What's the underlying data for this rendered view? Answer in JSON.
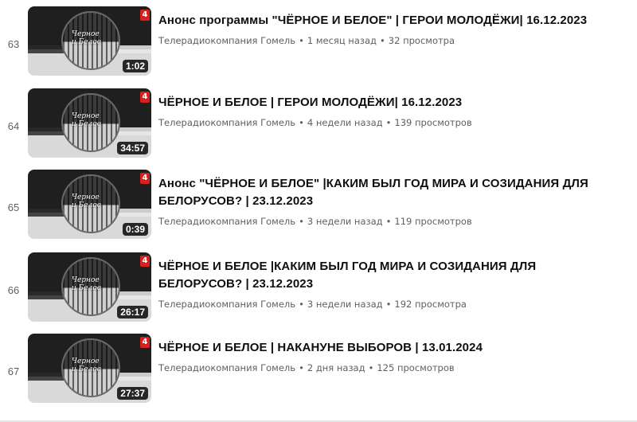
{
  "videos": [
    {
      "index": "63",
      "title": "Анонс программы \"ЧЁРНОЕ И БЕЛОЕ\" | ГЕРОИ МОЛОДЁЖИ| 16.12.2023",
      "channel": "Телерадиокомпания Гомель",
      "age": "1 месяц назад",
      "views": "32 просмотра",
      "duration": "1:02",
      "thumb_text": "Черное\nи Белое",
      "logo": "4"
    },
    {
      "index": "64",
      "title": "ЧЁРНОЕ И БЕЛОЕ | ГЕРОИ МОЛОДЁЖИ| 16.12.2023",
      "channel": "Телерадиокомпания Гомель",
      "age": "4 недели назад",
      "views": "139 просмотров",
      "duration": "34:57",
      "thumb_text": "Черное\nи Белое",
      "logo": "4"
    },
    {
      "index": "65",
      "title": "Анонс \"ЧЁРНОЕ И БЕЛОЕ\" |КАКИМ БЫЛ ГОД МИРА И СОЗИДАНИЯ ДЛЯ БЕЛОРУСОВ? | 23.12.2023",
      "channel": "Телерадиокомпания Гомель",
      "age": "3 недели назад",
      "views": "119 просмотров",
      "duration": "0:39",
      "thumb_text": "Черное\nи Белое",
      "logo": "4"
    },
    {
      "index": "66",
      "title": "ЧЁРНОЕ И БЕЛОЕ |КАКИМ БЫЛ ГОД МИРА И СОЗИДАНИЯ ДЛЯ БЕЛОРУСОВ? | 23.12.2023",
      "channel": "Телерадиокомпания Гомель",
      "age": "3 недели назад",
      "views": "192 просмотра",
      "duration": "26:17",
      "thumb_text": "Черное\nи Белое",
      "logo": "4"
    },
    {
      "index": "67",
      "title": "ЧЁРНОЕ И БЕЛОЕ | НАКАНУНЕ ВЫБОРОВ | 13.01.2024",
      "channel": "Телерадиокомпания Гомель",
      "age": "2 дня назад",
      "views": "125 просмотров",
      "duration": "27:37",
      "thumb_text": "Черное\nи Белое",
      "logo": "4"
    }
  ],
  "separator": "•",
  "colors": {
    "text": "#0f0f0f",
    "secondary": "#606060",
    "logo_red": "#d6211f"
  },
  "icons": {
    "channel_logo": "belarus-4-logo-icon"
  }
}
